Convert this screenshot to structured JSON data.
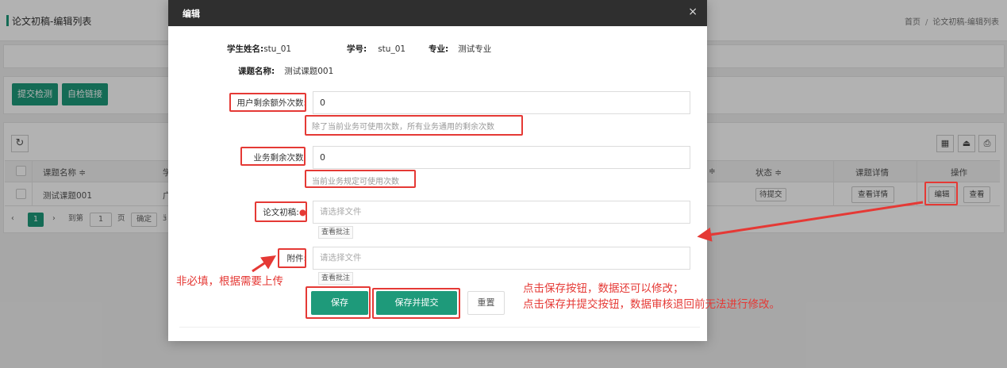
{
  "page": {
    "title": "论文初稿-编辑列表",
    "breadcrumb": [
      "首页",
      "论文初稿-编辑列表"
    ],
    "breadcrumb_separator": "/",
    "toolbar_buttons": [
      "提交检测",
      "自检链接"
    ],
    "refresh_icon": "refresh-icon",
    "tool_icons": [
      "columns-icon",
      "export-icon",
      "print-icon"
    ],
    "table": {
      "headers": {
        "name": "课题名称 ≑",
        "col2": "学",
        "col3": "≑",
        "status": "状态 ≑",
        "detail": "课题详情",
        "action": "操作"
      },
      "row": {
        "name": "测试课题001",
        "col2": "广",
        "status": "待提交",
        "detail": "查看详情",
        "edit": "编辑",
        "view": "查看"
      }
    },
    "pager": {
      "prev": "‹",
      "current": "1",
      "next": "›",
      "goto": "到第",
      "page_input": "1",
      "page_unit": "页",
      "confirm": "确定",
      "tail": "ӟ"
    }
  },
  "modal": {
    "title": "编辑",
    "close": "×",
    "student_name_label": "学生姓名:",
    "student_name": "stu_01",
    "student_id_label": "学号:",
    "student_id": "stu_01",
    "major_label": "专业:",
    "major": "测试专业",
    "topic_label": "课题名称:",
    "topic": "测试课题001",
    "fields": {
      "extra_count_label": "用户剩余额外次数:",
      "extra_count_value": "0",
      "extra_count_hint": "除了当前业务可使用次数，所有业务通用的剩余次数",
      "business_count_label": "业务剩余次数:",
      "business_count_value": "0",
      "business_count_hint": "当前业务规定可使用次数",
      "draft_label": "论文初稿:",
      "draft_required": "●",
      "draft_placeholder": "请选择文件",
      "draft_view": "查看批注",
      "attach_label": "附件:",
      "attach_placeholder": "请选择文件",
      "attach_view": "查看批注"
    },
    "buttons": {
      "save": "保存",
      "save_submit": "保存并提交",
      "reset": "重置"
    }
  },
  "annotations": {
    "optional_note": "非必填，根据需要上传",
    "save_note_1": "点击保存按钮，数据还可以修改；",
    "save_note_2": "点击保存并提交按钮，数据审核退回前无法进行修改。",
    "color": "#e53935"
  },
  "colors": {
    "primary": "#1e9a7a",
    "modal_header": "#2f2f2f",
    "annotation": "#e53935"
  }
}
